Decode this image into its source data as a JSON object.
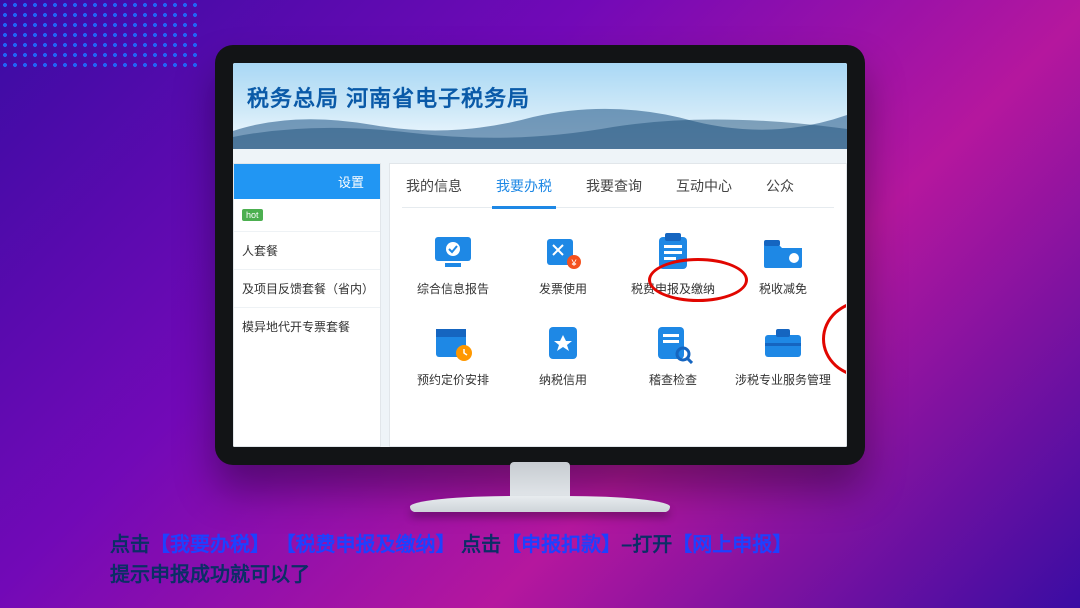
{
  "header": {
    "title": "税务总局 河南省电子税务局"
  },
  "sidebar": {
    "settings": "设置",
    "hot_badge": "hot",
    "items": [
      "人套餐",
      "及项目反馈套餐（省内）",
      "模异地代开专票套餐"
    ]
  },
  "tabs": [
    {
      "label": "我的信息",
      "active": false
    },
    {
      "label": "我要办税",
      "active": true
    },
    {
      "label": "我要查询",
      "active": false
    },
    {
      "label": "互动中心",
      "active": false
    },
    {
      "label": "公众",
      "active": false
    }
  ],
  "grid": {
    "row1": [
      {
        "label": "综合信息报告",
        "icon": "monitor-check",
        "color": "#1e88e5"
      },
      {
        "label": "发票使用",
        "icon": "edit-yen",
        "color": "#1e88e5"
      },
      {
        "label": "税费申报及缴纳",
        "icon": "clipboard",
        "color": "#1e88e5"
      },
      {
        "label": "税收减免",
        "icon": "folder",
        "color": "#1e88e5"
      }
    ],
    "row2": [
      {
        "label": "预约定价安排",
        "icon": "calendar-clock",
        "color": "#1e88e5"
      },
      {
        "label": "纳税信用",
        "icon": "star-badge",
        "color": "#1e88e5"
      },
      {
        "label": "稽查检查",
        "icon": "clipboard-search",
        "color": "#1e88e5"
      },
      {
        "label": "涉税专业服务管理",
        "icon": "briefcase",
        "color": "#1e88e5"
      }
    ]
  },
  "caption": {
    "line1_parts": [
      {
        "t": "点击",
        "hl": false
      },
      {
        "t": "【我要办税】",
        "hl": true
      },
      {
        "t": " ",
        "hl": false
      },
      {
        "t": "【税费申报及缴纳】",
        "hl": true
      },
      {
        "t": "  点击",
        "hl": false
      },
      {
        "t": "【申报扣款】",
        "hl": true
      },
      {
        "t": "–打开",
        "hl": false
      },
      {
        "t": "【网上申报】",
        "hl": true
      }
    ],
    "line2": "提示申报成功就可以了"
  }
}
